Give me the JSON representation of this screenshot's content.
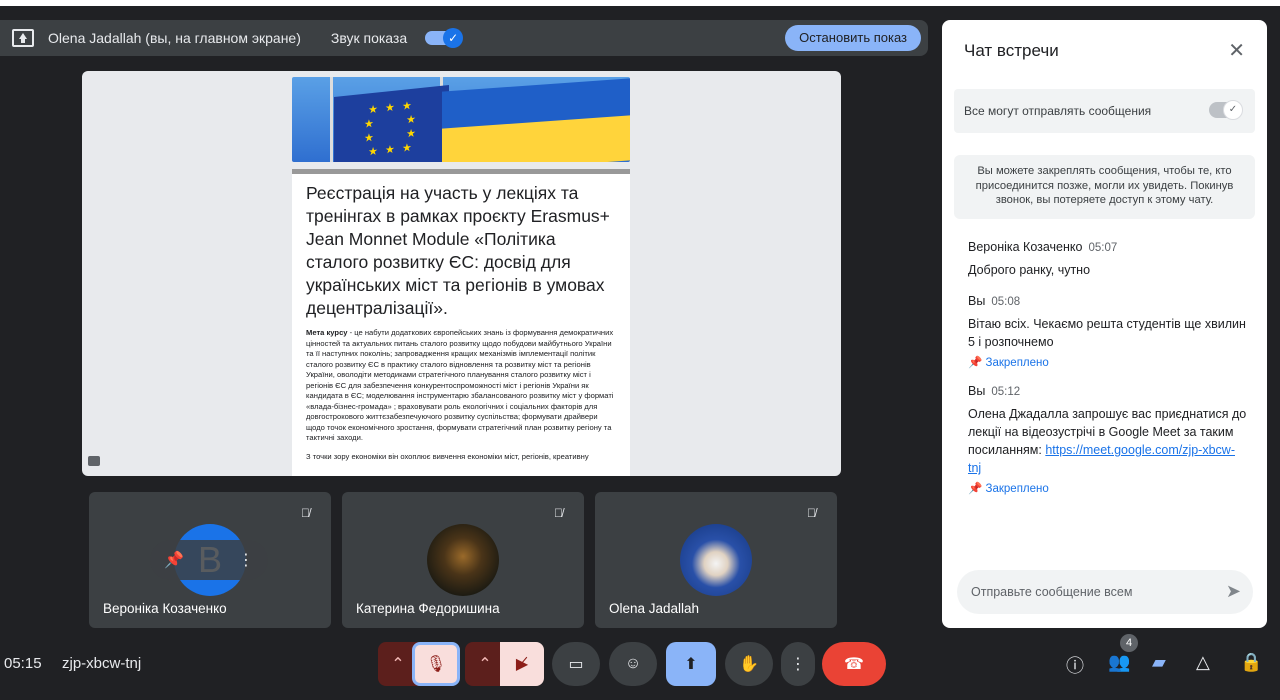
{
  "presentation_bar": {
    "title": "Olena Jadallah (вы, на главном экране)",
    "sound_label": "Звук показа",
    "stop_button": "Остановить показ"
  },
  "slide": {
    "title": "Реєстрація на участь у лекціях та тренінгах в рамках проєкту Erasmus+ Jean Monnet Module  «Політика сталого розвитку ЄС: досвід для українських міст та регіонів в умовах децентралізації».",
    "body_label": "Мета курсу",
    "body": " - це набути додаткових європейських  знань  із формування демократичних цінностей  та актуальних питань сталого розвитку щодо побудови майбутнього України  та її наступних поколінь;  запровадження кращих механізмів імплементації політик сталого розвитку ЄС в практику сталого відновлення та розвитку міст та регіонів України, оволодіти методиками стратегічного  планування сталого розвитку міст і регіонів  ЄС  для забезпечення конкурентоспроможності міст і регіонів України як кандидата в ЄС;  моделювання інструментарю  збалансованого  розвитку міст у форматі «влада-бізнес-громада» ; враховувати  роль екологічних і соціальних факторів для довгострокового життєзабезпечуючого розвитку суспільства;  формувати драйвери щодо точок економічного зростання, формувати стратегічний план розвитку регіону та тактичні заходи.",
    "body2": "З точки зору економіки він охоплює вивчення економіки міст, регіонів, креативну"
  },
  "participants": [
    {
      "name": "Вероніка Козаченко",
      "initial": "В"
    },
    {
      "name": "Катерина Федоришина"
    },
    {
      "name": "Olena Jadallah"
    }
  ],
  "bottom": {
    "time": "05:15",
    "meeting_code": "zjp-xbcw-tnj",
    "people_count": "4"
  },
  "chat": {
    "title": "Чат встречи",
    "allow_label": "Все могут отправлять сообщения",
    "info": "Вы можете закреплять сообщения, чтобы те, кто присоединится позже, могли их увидеть. Покинув звонок, вы потеряете доступ к этому чату.",
    "messages": [
      {
        "author": "Вероніка Козаченко",
        "time": "05:07",
        "text": "Доброго ранку, чутно"
      },
      {
        "author": "Вы",
        "time": "05:08",
        "text": "Вітаю всіх. Чекаємо решта студентів ще хвилин 5 і розпочнемо",
        "pinned": "Закреплено"
      },
      {
        "author": "Вы",
        "time": "05:12",
        "text": "Олена Джадалла запрошує вас приєднатися до лекції на відеозустрічі в Google Meet за таким посиланням: ",
        "link": "https://meet.google.com/zjp-xbcw-tnj",
        "pinned": "Закреплено"
      }
    ],
    "input_placeholder": "Отправьте сообщение всем"
  }
}
